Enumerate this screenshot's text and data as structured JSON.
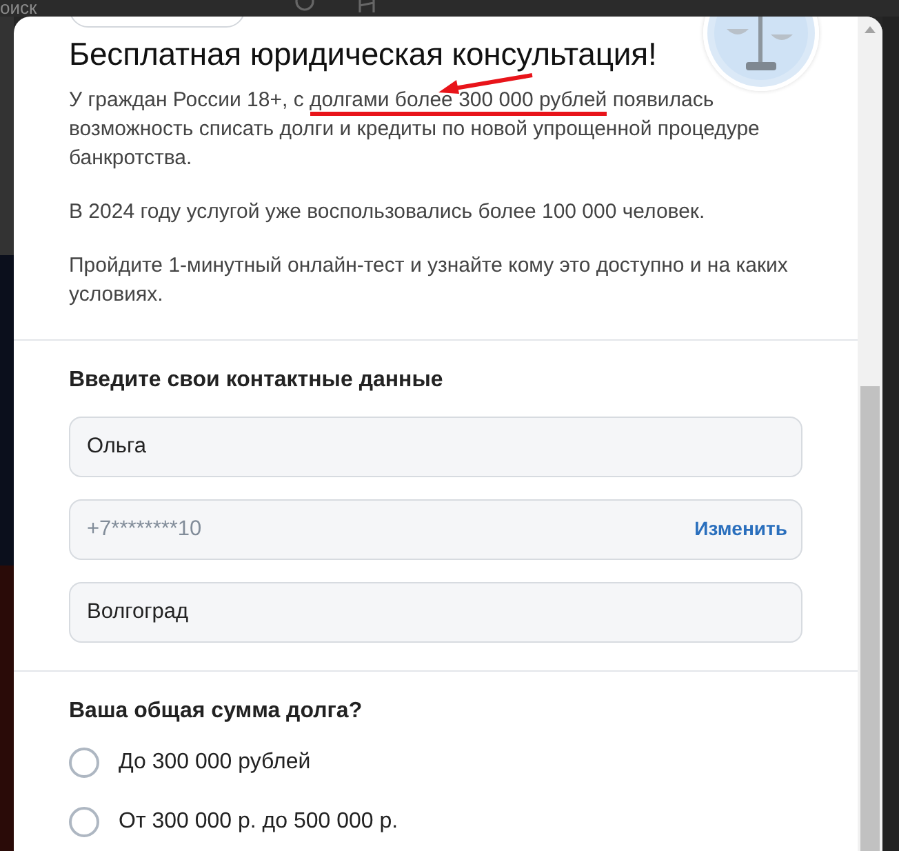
{
  "background": {
    "search_text": "оиск"
  },
  "modal": {
    "title": "Бесплатная юридическая консультация!",
    "paragraphs": [
      {
        "before": "У граждан России 18+, с ",
        "marked": "долгами более 300 000 рублей",
        "after": " появилась возможность списать долги и кредиты по новой упрощенной процедуре банкротства."
      },
      {
        "before": "В 2024 году услугой уже воспользовались более 100 000 человек."
      },
      {
        "before": "Пройдите 1-минутный онлайн-тест и узнайте кому это доступно и на каких условиях."
      }
    ],
    "annotation": {
      "kind": "arrow"
    },
    "contacts": {
      "heading": "Введите свои контактные данные",
      "fields": [
        {
          "kind": "text",
          "value": "Ольга",
          "disabled": false
        },
        {
          "kind": "phone",
          "value": "+7********10",
          "disabled": true,
          "action": "Изменить"
        },
        {
          "kind": "text",
          "value": "Волгоград",
          "disabled": false
        }
      ]
    },
    "question": {
      "title": "Ваша общая сумма долга?",
      "options": [
        {
          "label": "До 300 000 рублей",
          "selected": false
        },
        {
          "label": "От 300 000 р. до 500 000 р.",
          "selected": false
        }
      ]
    }
  }
}
